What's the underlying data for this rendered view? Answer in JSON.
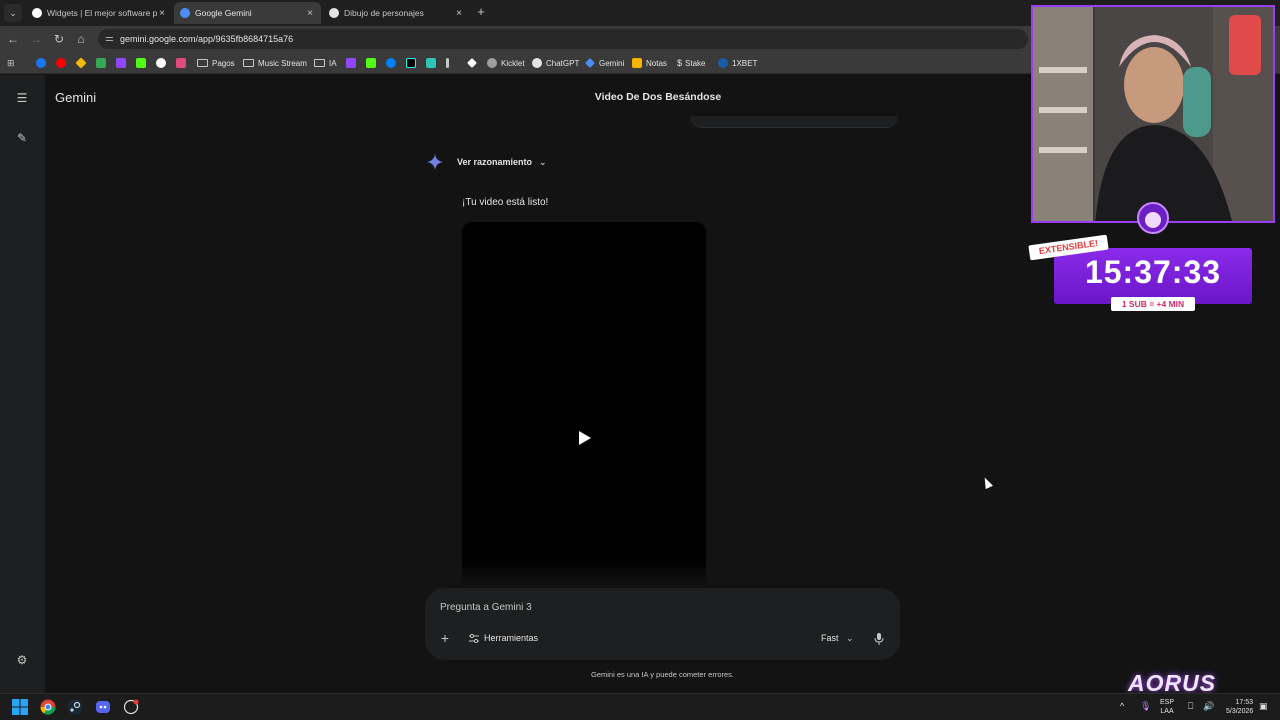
{
  "browser": {
    "tabs": [
      {
        "title": "Widgets | El mejor software par",
        "favicon": "widgets-icon",
        "active": false
      },
      {
        "title": "Google Gemini",
        "favicon": "gemini-icon",
        "active": true
      },
      {
        "title": "Dibujo de personajes",
        "favicon": "openai-icon",
        "active": false
      }
    ],
    "url": "gemini.google.com/app/9635fb8684715a76",
    "bookmarks": [
      "Pagos",
      "Music Stream",
      "IA",
      "Kicklet",
      "ChatGPT",
      "Gemini",
      "Notas",
      "Stake",
      "1XBET"
    ]
  },
  "app": {
    "name": "Gemini",
    "conversation_title": "Video De Dos Besándose",
    "reasoning_label": "Ver razonamiento",
    "response_text": "¡Tu video está listo!",
    "input_placeholder": "Pregunta a Gemini 3",
    "tools_label": "Herramientas",
    "model_label": "Fast",
    "disclaimer": "Gemini es una IA y puede cometer errores."
  },
  "overlay": {
    "extensible_label": "EXTENSIBLE!",
    "timer": "15:37:33",
    "sub_rule": "1 SUB = +4 MIN",
    "brand": "AORUS"
  },
  "taskbar": {
    "lang_top": "ESP",
    "lang_bottom": "LAA",
    "time": "17:53",
    "date": "5/3/2026"
  }
}
